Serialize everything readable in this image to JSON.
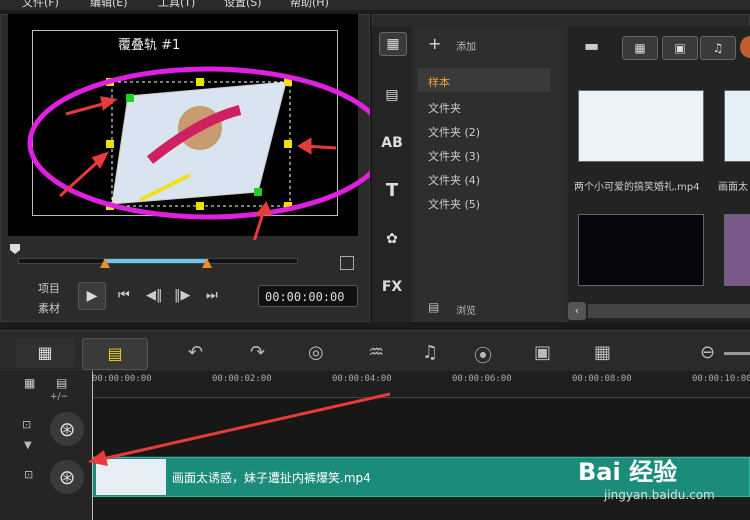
{
  "menu": [
    "文件(F)",
    "编辑(E)",
    "工具(T)",
    "设置(S)",
    "帮助(H)"
  ],
  "preview": {
    "overlay_label": "覆叠轨 #1",
    "labels": {
      "project": "项目",
      "clip": "素材"
    },
    "timecode": "00:00:00:00"
  },
  "library": {
    "add_label": "添加",
    "folders": [
      {
        "label": "样本",
        "selected": true
      },
      {
        "label": "文件夹",
        "selected": false
      },
      {
        "label": "文件夹 (2)",
        "selected": false
      },
      {
        "label": "文件夹 (3)",
        "selected": false
      },
      {
        "label": "文件夹 (4)",
        "selected": false
      },
      {
        "label": "文件夹 (5)",
        "selected": false
      }
    ],
    "browse_label": "浏览",
    "thumbs": [
      {
        "label": "两个小可爱的搞笑婚礼.mp4"
      },
      {
        "label": "画面太"
      }
    ],
    "side_tools": [
      "media-icon",
      "transition-icon",
      "title-ab-icon",
      "title-t-icon",
      "graphics-icon",
      "fx-icon"
    ],
    "fx_label": "FX",
    "ab_label": "AB",
    "t_label": "T"
  },
  "timeline": {
    "ruler": [
      "00:00:00:00",
      "00:00:02:00",
      "00:00:04:00",
      "00:00:06:00",
      "00:00:08:00",
      "00:00:10:00"
    ],
    "clip_title": "画面太诱惑，妹子遭扯内裤爆笑.mp4",
    "zoom_minus": "⊖",
    "plus_minus": "+/−"
  },
  "watermark": {
    "brand": "Bai 经验",
    "url": "jingyan.baidu.com"
  },
  "colors": {
    "annotation_ellipse": "#e020e0",
    "annotation_arrow": "#e83a3a",
    "clip": "#1c8c7a",
    "trim": "#f08a24",
    "selection": "#f0a030"
  }
}
